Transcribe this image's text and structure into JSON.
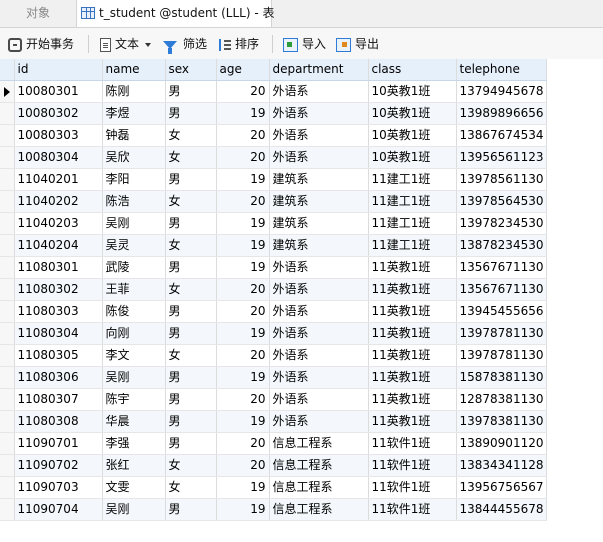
{
  "tabs": [
    {
      "label": "对象",
      "active": false
    },
    {
      "label": "t_student @student (LLL) - 表",
      "active": true
    }
  ],
  "toolbar": {
    "begin_transaction": "开始事务",
    "text": "文本",
    "filter": "筛选",
    "sort": "排序",
    "import": "导入",
    "export": "导出"
  },
  "grid": {
    "columns": [
      "id",
      "name",
      "sex",
      "age",
      "department",
      "class",
      "telephone"
    ],
    "rows": [
      [
        "10080301",
        "陈刚",
        "男",
        "20",
        "外语系",
        "10英教1班",
        "13794945678"
      ],
      [
        "10080302",
        "李煜",
        "男",
        "19",
        "外语系",
        "10英教1班",
        "13989896656"
      ],
      [
        "10080303",
        "钟磊",
        "女",
        "20",
        "外语系",
        "10英教1班",
        "13867674534"
      ],
      [
        "10080304",
        "吴欣",
        "女",
        "20",
        "外语系",
        "10英教1班",
        "13956561123"
      ],
      [
        "11040201",
        "李阳",
        "男",
        "19",
        "建筑系",
        "11建工1班",
        "13978561130"
      ],
      [
        "11040202",
        "陈浩",
        "女",
        "20",
        "建筑系",
        "11建工1班",
        "13978564530"
      ],
      [
        "11040203",
        "吴刚",
        "男",
        "19",
        "建筑系",
        "11建工1班",
        "13978234530"
      ],
      [
        "11040204",
        "吴灵",
        "女",
        "19",
        "建筑系",
        "11建工1班",
        "13878234530"
      ],
      [
        "11080301",
        "武陵",
        "男",
        "19",
        "外语系",
        "11英教1班",
        "13567671130"
      ],
      [
        "11080302",
        "王菲",
        "女",
        "20",
        "外语系",
        "11英教1班",
        "13567671130"
      ],
      [
        "11080303",
        "陈俊",
        "男",
        "20",
        "外语系",
        "11英教1班",
        "13945455656"
      ],
      [
        "11080304",
        "向刚",
        "男",
        "19",
        "外语系",
        "11英教1班",
        "13978781130"
      ],
      [
        "11080305",
        "李文",
        "女",
        "20",
        "外语系",
        "11英教1班",
        "13978781130"
      ],
      [
        "11080306",
        "吴刚",
        "男",
        "19",
        "外语系",
        "11英教1班",
        "15878381130"
      ],
      [
        "11080307",
        "陈宇",
        "男",
        "20",
        "外语系",
        "11英教1班",
        "12878381130"
      ],
      [
        "11080308",
        "华晨",
        "男",
        "19",
        "外语系",
        "11英教1班",
        "13978381130"
      ],
      [
        "11090701",
        "李强",
        "男",
        "20",
        "信息工程系",
        "11软件1班",
        "13890901120"
      ],
      [
        "11090702",
        "张红",
        "女",
        "20",
        "信息工程系",
        "11软件1班",
        "13834341128"
      ],
      [
        "11090703",
        "文雯",
        "女",
        "19",
        "信息工程系",
        "11软件1班",
        "13956756567"
      ],
      [
        "11090704",
        "吴刚",
        "男",
        "19",
        "信息工程系",
        "11软件1班",
        "13844455678"
      ]
    ]
  }
}
